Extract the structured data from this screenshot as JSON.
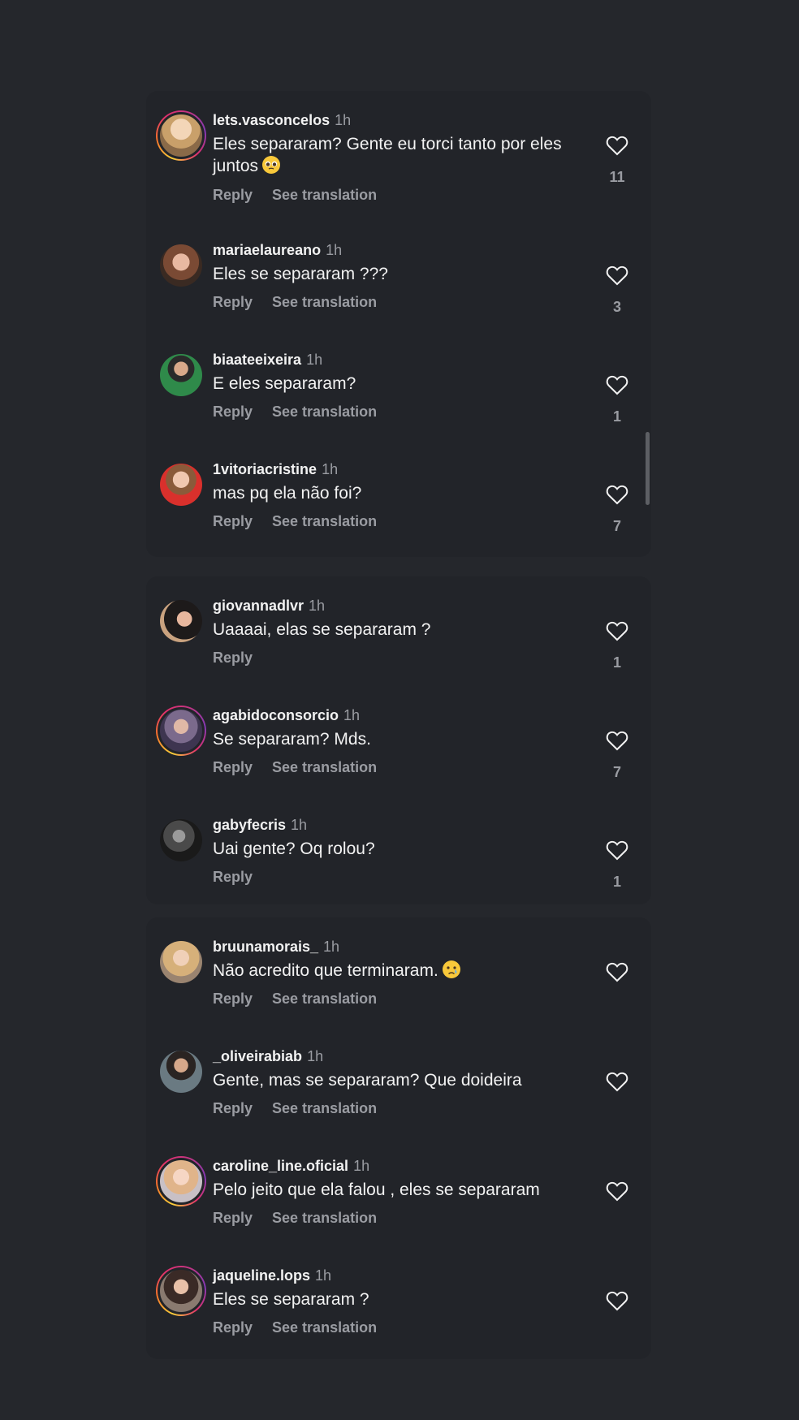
{
  "ui": {
    "reply_label": "Reply",
    "see_translation_label": "See translation",
    "accent_colors": [
      "#f9d03a",
      "#e1306c",
      "#833ab4"
    ],
    "text_color": "#f2f2f2",
    "muted_color": "#9a9ca2",
    "background": "#25272c"
  },
  "cards": [
    {
      "comments": [
        {
          "username": "lets.vasconcelos",
          "time": "1h",
          "text": "Eles separaram? Gente eu torci tanto por eles juntos",
          "emoji": "pleading-face",
          "likes": "11",
          "has_story": true,
          "see_translation": true
        },
        {
          "username": "mariaelaureano",
          "time": "1h",
          "text": "Eles se separaram ???",
          "likes": "3",
          "has_story": false,
          "see_translation": true
        },
        {
          "username": "biaateeixeira",
          "time": "1h",
          "text": "E eles separaram?",
          "likes": "1",
          "has_story": false,
          "see_translation": true
        },
        {
          "username": "1vitoriacristine",
          "time": "1h",
          "text": "mas pq ela não foi?",
          "likes": "7",
          "has_story": false,
          "see_translation": true
        }
      ]
    },
    {
      "comments": [
        {
          "username": "giovannadlvr",
          "time": "1h",
          "text": "Uaaaai, elas se separaram ?",
          "likes": "1",
          "has_story": false,
          "see_translation": false
        },
        {
          "username": "agabidoconsorcio",
          "time": "1h",
          "text": "Se separaram? Mds.",
          "likes": "7",
          "has_story": true,
          "see_translation": true
        },
        {
          "username": "gabyfecris",
          "time": "1h",
          "text": "Uai gente? Oq rolou?",
          "likes": "1",
          "has_story": false,
          "see_translation": false
        }
      ]
    },
    {
      "comments": [
        {
          "username": "bruunamorais_",
          "time": "1h",
          "text": "Não acredito que terminaram.",
          "emoji": "crying-face",
          "likes": "",
          "has_story": false,
          "see_translation": true
        },
        {
          "username": "_oliveirabiab",
          "time": "1h",
          "text": "Gente, mas se separaram? Que doideira",
          "likes": "",
          "has_story": false,
          "see_translation": true
        },
        {
          "username": "caroline_line.oficial",
          "time": "1h",
          "text": "Pelo jeito que ela falou , eles se separaram",
          "likes": "",
          "has_story": true,
          "see_translation": true
        },
        {
          "username": "jaqueline.lops",
          "time": "1h",
          "text": "Eles se separaram ?",
          "likes": "",
          "has_story": true,
          "see_translation": true
        }
      ]
    }
  ]
}
